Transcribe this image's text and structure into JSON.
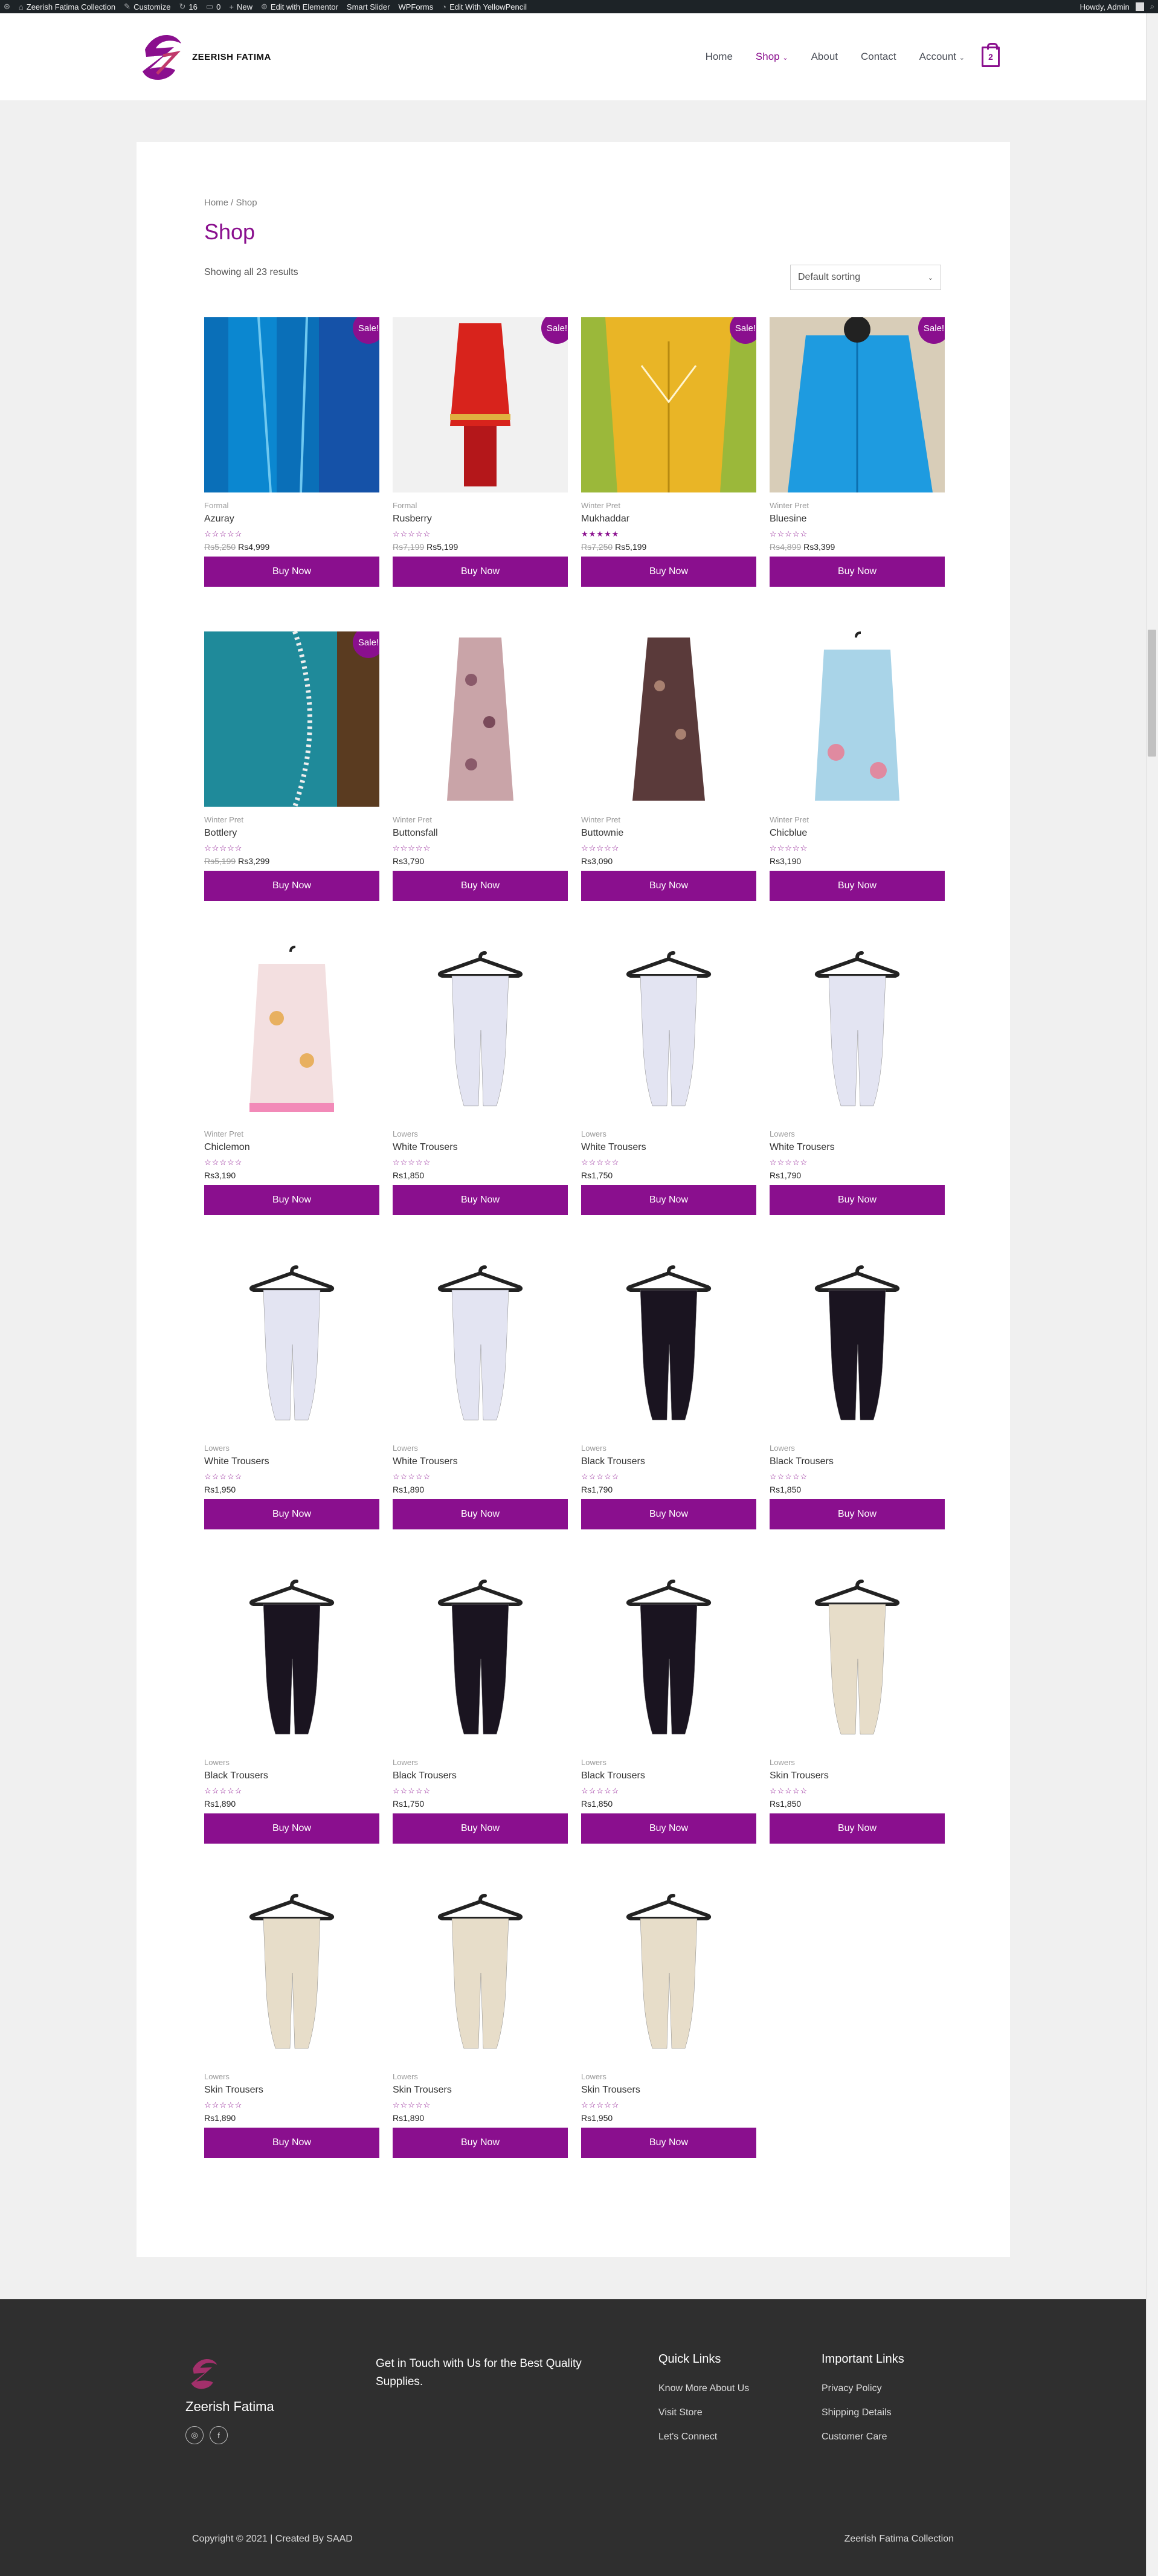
{
  "adminbar": {
    "site": "Zeerish Fatima Collection",
    "customize": "Customize",
    "updates": "16",
    "comments": "0",
    "new": "New",
    "elementor": "Edit with Elementor",
    "smartslider": "Smart Slider",
    "wpforms": "WPForms",
    "yellowpencil": "Edit With YellowPencil",
    "greeting": "Howdy, Admin"
  },
  "header": {
    "logo_text": "ZEERISH FATIMA",
    "nav": [
      "Home",
      "Shop",
      "About",
      "Contact",
      "Account"
    ],
    "cart_count": "2"
  },
  "main": {
    "breadcrumb_home": "Home",
    "breadcrumb_sep": " / ",
    "breadcrumb_current": "Shop",
    "title": "Shop",
    "result_count": "Showing all 23 results",
    "sorting": "Default sorting",
    "button_label": "Buy Now",
    "sale_label": "Sale!"
  },
  "products": [
    {
      "cat": "Formal",
      "title": "Azuray",
      "old": "Rs5,250",
      "price": "Rs4,999",
      "sale": true,
      "stars": "☆☆☆☆☆",
      "img": "blue-embroid"
    },
    {
      "cat": "Formal",
      "title": "Rusberry",
      "old": "Rs7,199",
      "price": "Rs5,199",
      "sale": true,
      "stars": "☆☆☆☆☆",
      "img": "red-dress"
    },
    {
      "cat": "Winter Pret",
      "title": "Mukhaddar",
      "old": "Rs7,250",
      "price": "Rs5,199",
      "sale": true,
      "stars": "★★★★★",
      "img": "yellow"
    },
    {
      "cat": "Winter Pret",
      "title": "Bluesine",
      "old": "Rs4,899",
      "price": "Rs3,399",
      "sale": true,
      "stars": "☆☆☆☆☆",
      "img": "blue-shirt"
    },
    {
      "cat": "Winter Pret",
      "title": "Bottlery",
      "old": "Rs5,199",
      "price": "Rs3,299",
      "sale": true,
      "stars": "☆☆☆☆☆",
      "img": "teal"
    },
    {
      "cat": "Winter Pret",
      "title": "Buttonsfall",
      "old": "",
      "price": "Rs3,790",
      "sale": false,
      "stars": "☆☆☆☆☆",
      "img": "floral-long"
    },
    {
      "cat": "Winter Pret",
      "title": "Buttownie",
      "old": "",
      "price": "Rs3,090",
      "sale": false,
      "stars": "☆☆☆☆☆",
      "img": "brown-long"
    },
    {
      "cat": "Winter Pret",
      "title": "Chicblue",
      "old": "",
      "price": "Rs3,190",
      "sale": false,
      "stars": "☆☆☆☆☆",
      "img": "light-blue"
    },
    {
      "cat": "Winter Pret",
      "title": "Chiclemon",
      "old": "",
      "price": "Rs3,190",
      "sale": false,
      "stars": "☆☆☆☆☆",
      "img": "pink-floral"
    },
    {
      "cat": "Lowers",
      "title": "White Trousers",
      "old": "",
      "price": "Rs1,850",
      "sale": false,
      "stars": "☆☆☆☆☆",
      "img": "white-trouser"
    },
    {
      "cat": "Lowers",
      "title": "White Trousers",
      "old": "",
      "price": "Rs1,750",
      "sale": false,
      "stars": "☆☆☆☆☆",
      "img": "white-trouser"
    },
    {
      "cat": "Lowers",
      "title": "White Trousers",
      "old": "",
      "price": "Rs1,790",
      "sale": false,
      "stars": "☆☆☆☆☆",
      "img": "white-trouser"
    },
    {
      "cat": "Lowers",
      "title": "White Trousers",
      "old": "",
      "price": "Rs1,950",
      "sale": false,
      "stars": "☆☆☆☆☆",
      "img": "white-trouser"
    },
    {
      "cat": "Lowers",
      "title": "White Trousers",
      "old": "",
      "price": "Rs1,890",
      "sale": false,
      "stars": "☆☆☆☆☆",
      "img": "white-trouser"
    },
    {
      "cat": "Lowers",
      "title": "Black Trousers",
      "old": "",
      "price": "Rs1,790",
      "sale": false,
      "stars": "☆☆☆☆☆",
      "img": "black-trouser"
    },
    {
      "cat": "Lowers",
      "title": "Black Trousers",
      "old": "",
      "price": "Rs1,850",
      "sale": false,
      "stars": "☆☆☆☆☆",
      "img": "black-trouser"
    },
    {
      "cat": "Lowers",
      "title": "Black Trousers",
      "old": "",
      "price": "Rs1,890",
      "sale": false,
      "stars": "☆☆☆☆☆",
      "img": "black-trouser"
    },
    {
      "cat": "Lowers",
      "title": "Black Trousers",
      "old": "",
      "price": "Rs1,750",
      "sale": false,
      "stars": "☆☆☆☆☆",
      "img": "black-trouser"
    },
    {
      "cat": "Lowers",
      "title": "Black Trousers",
      "old": "",
      "price": "Rs1,850",
      "sale": false,
      "stars": "☆☆☆☆☆",
      "img": "black-trouser"
    },
    {
      "cat": "Lowers",
      "title": "Skin Trousers",
      "old": "",
      "price": "Rs1,850",
      "sale": false,
      "stars": "☆☆☆☆☆",
      "img": "skin-trouser"
    },
    {
      "cat": "Lowers",
      "title": "Skin Trousers",
      "old": "",
      "price": "Rs1,890",
      "sale": false,
      "stars": "☆☆☆☆☆",
      "img": "skin-trouser"
    },
    {
      "cat": "Lowers",
      "title": "Skin Trousers",
      "old": "",
      "price": "Rs1,890",
      "sale": false,
      "stars": "☆☆☆☆☆",
      "img": "skin-trouser"
    },
    {
      "cat": "Lowers",
      "title": "Skin Trousers",
      "old": "",
      "price": "Rs1,950",
      "sale": false,
      "stars": "☆☆☆☆☆",
      "img": "skin-trouser"
    }
  ],
  "footer": {
    "brand": "Zeerish Fatima",
    "tagline": "Get in Touch with Us for the Best Quality Supplies.",
    "quick_title": "Quick Links",
    "quick_links": [
      "Know More About Us",
      "Visit Store",
      "Let's Connect"
    ],
    "important_title": "Important Links",
    "important_links": [
      "Privacy Policy",
      "Shipping Details",
      "Customer Care"
    ],
    "copyright": "Copyright © 2021 | Created By SAAD",
    "site_name": "Zeerish Fatima Collection"
  },
  "colors": {
    "accent": "#8a0f8e",
    "footer_bg": "#2f2f2f",
    "adminbar_bg": "#1d2327"
  }
}
